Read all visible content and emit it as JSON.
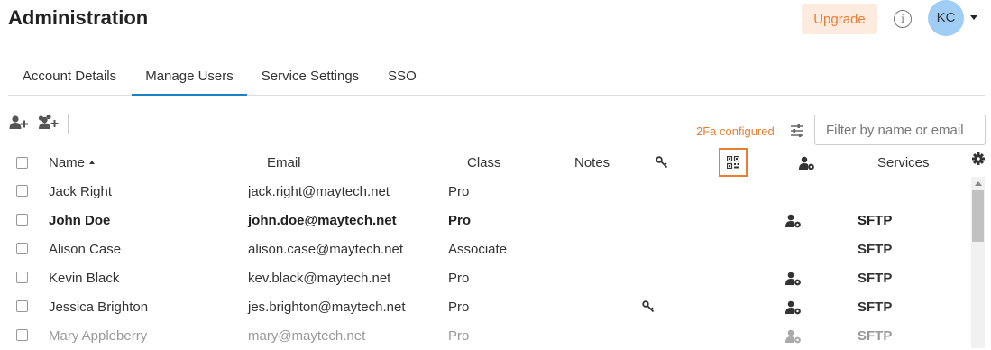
{
  "header": {
    "title": "Administration",
    "upgrade_label": "Upgrade",
    "info_symbol": "i",
    "avatar_initials": "KC"
  },
  "tabs": [
    {
      "label": "Account Details",
      "active": false
    },
    {
      "label": "Manage Users",
      "active": true
    },
    {
      "label": "Service Settings",
      "active": false
    },
    {
      "label": "SSO",
      "active": false
    }
  ],
  "toolbar": {
    "add_user_icon": "add-user-icon",
    "add_users_icon": "add-users-icon",
    "twofa_label": "2Fa configured",
    "filter_icon": "sliders-icon",
    "search_placeholder": "Filter by name or email"
  },
  "table": {
    "columns": {
      "name": "Name",
      "email": "Email",
      "class": "Class",
      "notes": "Notes",
      "key_icon": "key-icon",
      "qr_icon": "qr-code-icon",
      "user_settings_icon": "user-gear-icon",
      "services": "Services",
      "settings_icon": "gear-icon"
    },
    "sort": {
      "column": "Name",
      "direction": "ascending"
    },
    "rows": [
      {
        "name": "Jack Right",
        "email": "jack.right@maytech.net",
        "class": "Pro",
        "key": false,
        "user_gear": false,
        "services": "",
        "style": "normal"
      },
      {
        "name": "John Doe",
        "email": "john.doe@maytech.net",
        "class": "Pro",
        "key": false,
        "user_gear": true,
        "services": "SFTP",
        "style": "bold"
      },
      {
        "name": "Alison Case",
        "email": "alison.case@maytech.net",
        "class": "Associate",
        "key": false,
        "user_gear": false,
        "services": "SFTP",
        "style": "normal"
      },
      {
        "name": "Kevin Black",
        "email": "kev.black@maytech.net",
        "class": "Pro",
        "key": false,
        "user_gear": true,
        "services": "SFTP",
        "style": "normal"
      },
      {
        "name": "Jessica Brighton",
        "email": "jes.brighton@maytech.net",
        "class": "Pro",
        "key": true,
        "user_gear": true,
        "services": "SFTP",
        "style": "normal"
      },
      {
        "name": "Mary Appleberry",
        "email": "mary@maytech.net",
        "class": "Pro",
        "key": false,
        "user_gear": true,
        "services": "SFTP",
        "style": "dim"
      }
    ]
  },
  "colors": {
    "accent_orange": "#e67e33",
    "tab_active": "#1d7fc4",
    "upgrade_bg": "#fdebe0",
    "avatar_bg": "#9fcdf5"
  }
}
